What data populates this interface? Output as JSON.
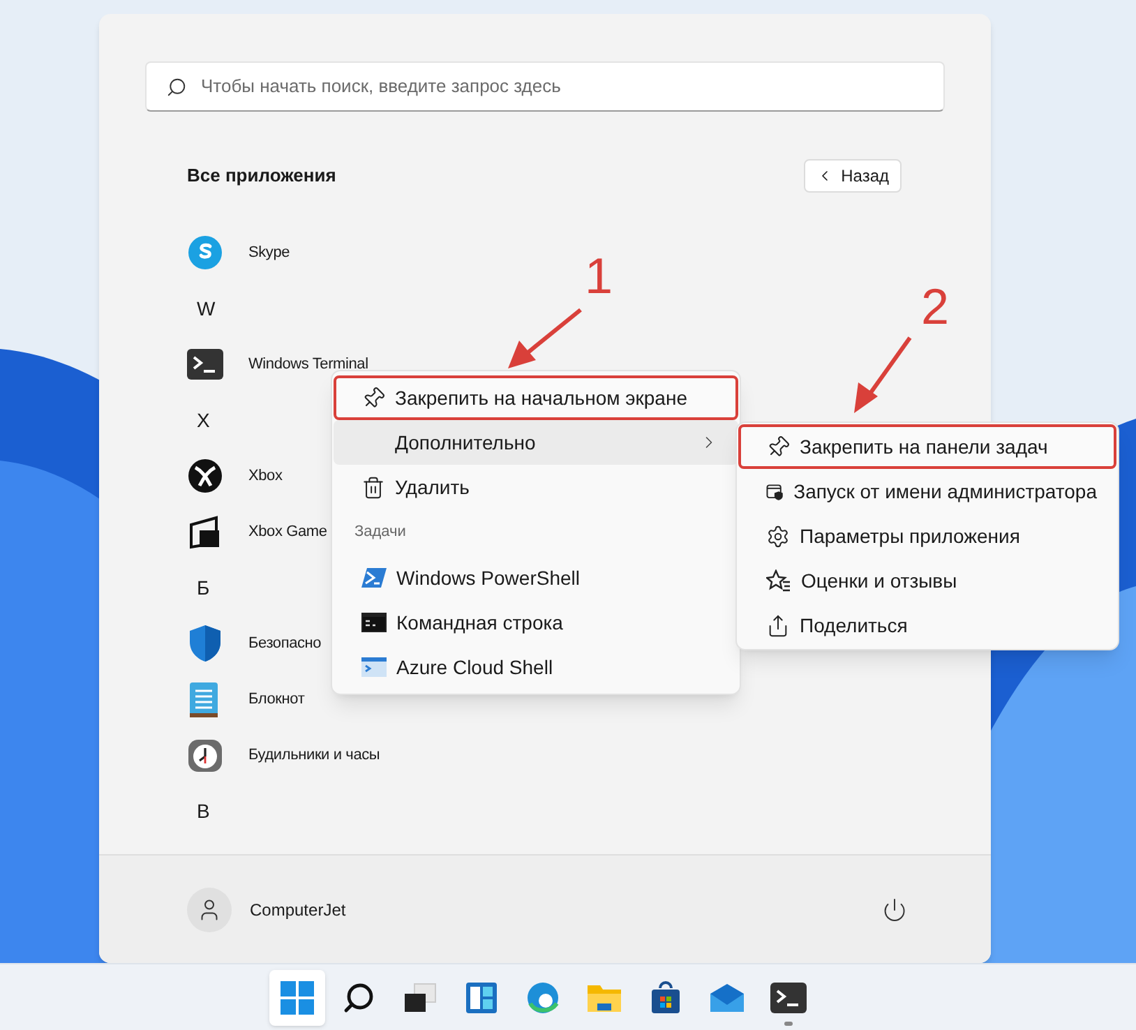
{
  "search": {
    "placeholder": "Чтобы начать поиск, введите запрос здесь"
  },
  "all_apps": {
    "title": "Все приложения",
    "back_button": "Назад"
  },
  "apps": [
    {
      "kind": "app",
      "name": "Skype"
    },
    {
      "kind": "letter",
      "name": "W"
    },
    {
      "kind": "app",
      "name": "Windows Terminal"
    },
    {
      "kind": "letter",
      "name": "X"
    },
    {
      "kind": "app",
      "name": "Xbox"
    },
    {
      "kind": "app",
      "name": "Xbox Game"
    },
    {
      "kind": "letter",
      "name": "Б"
    },
    {
      "kind": "app",
      "name": "Безопасно"
    },
    {
      "kind": "app",
      "name": "Блокнот"
    },
    {
      "kind": "app",
      "name": "Будильники и часы"
    },
    {
      "kind": "letter",
      "name": "В"
    }
  ],
  "user": {
    "name": "ComputerJet"
  },
  "context_menu": {
    "items": [
      {
        "kind": "item",
        "label": "Закрепить на начальном экране",
        "highlighted": true,
        "hovered": false,
        "submenu": false
      },
      {
        "kind": "item",
        "label": "Дополнительно",
        "highlighted": false,
        "hovered": true,
        "submenu": true
      },
      {
        "kind": "item",
        "label": "Удалить",
        "highlighted": false,
        "hovered": false,
        "submenu": false
      },
      {
        "kind": "header",
        "label": "Задачи"
      },
      {
        "kind": "item",
        "label": "Windows PowerShell",
        "highlighted": false,
        "hovered": false,
        "submenu": false
      },
      {
        "kind": "item",
        "label": "Командная строка",
        "highlighted": false,
        "hovered": false,
        "submenu": false
      },
      {
        "kind": "item",
        "label": "Azure Cloud Shell",
        "highlighted": false,
        "hovered": false,
        "submenu": false
      }
    ]
  },
  "submenu": {
    "items": [
      {
        "label": "Закрепить на панели задач",
        "highlighted": true
      },
      {
        "label": "Запуск от имени администратора",
        "highlighted": false
      },
      {
        "label": "Параметры приложения",
        "highlighted": false
      },
      {
        "label": "Оценки и отзывы",
        "highlighted": false
      },
      {
        "label": "Поделиться",
        "highlighted": false
      }
    ]
  },
  "annotations": [
    {
      "label": "1"
    },
    {
      "label": "2"
    }
  ],
  "taskbar": {
    "items": [
      {
        "selected": true,
        "running": false
      },
      {
        "selected": false,
        "running": false
      },
      {
        "selected": false,
        "running": false
      },
      {
        "selected": false,
        "running": false
      },
      {
        "selected": false,
        "running": false
      },
      {
        "selected": false,
        "running": false
      },
      {
        "selected": false,
        "running": false
      },
      {
        "selected": false,
        "running": false
      },
      {
        "selected": false,
        "running": true
      }
    ]
  }
}
